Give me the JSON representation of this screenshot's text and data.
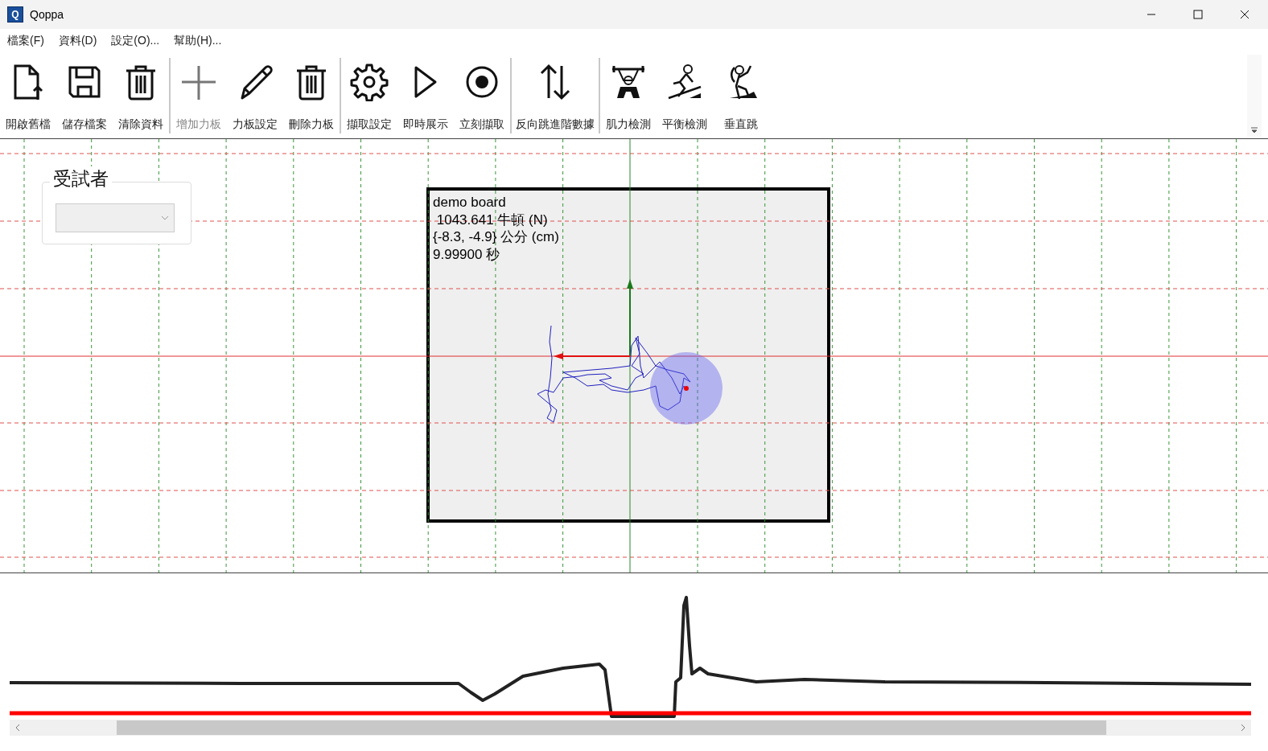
{
  "window": {
    "title": "Qoppa",
    "app_icon_letter": "Q"
  },
  "menu": [
    "檔案(F)",
    "資料(D)",
    "設定(O)...",
    "幫助(H)..."
  ],
  "toolbar_groups": [
    [
      {
        "label": "開啟舊檔",
        "kind": "open",
        "disabled": false
      },
      {
        "label": "儲存檔案",
        "kind": "save",
        "disabled": false
      },
      {
        "label": "清除資料",
        "kind": "trash",
        "disabled": false
      }
    ],
    [
      {
        "label": "增加力板",
        "kind": "plus",
        "disabled": true
      },
      {
        "label": "力板設定",
        "kind": "pencil",
        "disabled": false
      },
      {
        "label": "刪除力板",
        "kind": "trash",
        "disabled": false
      }
    ],
    [
      {
        "label": "擷取設定",
        "kind": "gear",
        "disabled": false
      },
      {
        "label": "即時展示",
        "kind": "play",
        "disabled": false
      },
      {
        "label": "立刻擷取",
        "kind": "record",
        "disabled": false
      }
    ],
    [
      {
        "label": "反向跳進階數據",
        "kind": "updown",
        "disabled": false
      }
    ],
    [
      {
        "label": "肌力檢測",
        "kind": "lifter",
        "disabled": false
      },
      {
        "label": "平衡檢測",
        "kind": "skier",
        "disabled": false
      },
      {
        "label": "垂直跳",
        "kind": "jumper",
        "disabled": false
      }
    ]
  ],
  "subject": {
    "legend": "受試者",
    "disabled": true
  },
  "board": {
    "name": "demo board",
    "force": " 1043.641 牛頓 (N)",
    "position": "{-8.3, -4.9} 公分 (cm)",
    "time": "9.99900 秒"
  }
}
